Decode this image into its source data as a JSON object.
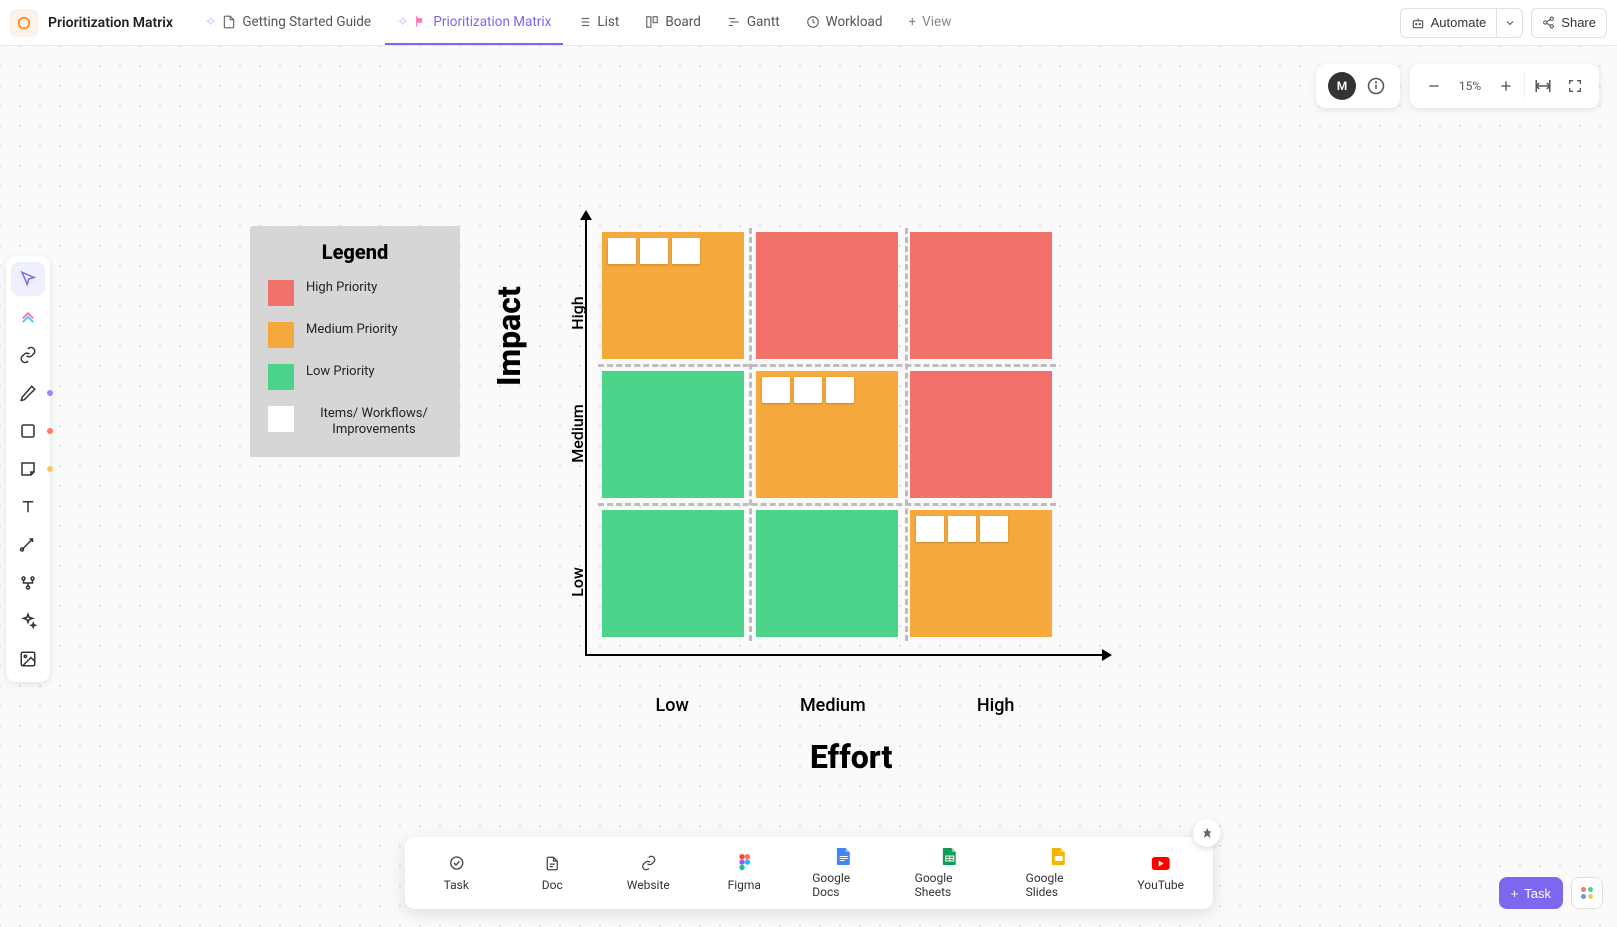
{
  "header": {
    "page_title": "Prioritization Matrix",
    "tabs": [
      {
        "label": "Getting Started Guide"
      },
      {
        "label": "Prioritization Matrix"
      },
      {
        "label": "List"
      },
      {
        "label": "Board"
      },
      {
        "label": "Gantt"
      },
      {
        "label": "Workload"
      }
    ],
    "add_view_label": "View",
    "automate_label": "Automate",
    "share_label": "Share"
  },
  "presence": {
    "avatar_initial": "M"
  },
  "zoom": {
    "percent_label": "15%"
  },
  "legend": {
    "title": "Legend",
    "items": [
      {
        "label": "High Priority",
        "color": "#f2716a"
      },
      {
        "label": "Medium Priority",
        "color": "#f5a83c"
      },
      {
        "label": "Low Priority",
        "color": "#4cd58a"
      },
      {
        "label": "Items/ Workflows/ Improvements",
        "color": "#ffffff"
      }
    ]
  },
  "matrix": {
    "y_axis_label": "Impact",
    "x_axis_label": "Effort",
    "y_ticks": [
      "High",
      "Medium",
      "Low"
    ],
    "x_ticks": [
      "Low",
      "Medium",
      "High"
    ],
    "cells": [
      {
        "row": "High",
        "col": "Low",
        "priority": "medium",
        "cards": 3
      },
      {
        "row": "High",
        "col": "Medium",
        "priority": "high",
        "cards": 0
      },
      {
        "row": "High",
        "col": "High",
        "priority": "high",
        "cards": 0
      },
      {
        "row": "Medium",
        "col": "Low",
        "priority": "low",
        "cards": 0
      },
      {
        "row": "Medium",
        "col": "Medium",
        "priority": "medium",
        "cards": 3
      },
      {
        "row": "Medium",
        "col": "High",
        "priority": "high",
        "cards": 0
      },
      {
        "row": "Low",
        "col": "Low",
        "priority": "low",
        "cards": 0
      },
      {
        "row": "Low",
        "col": "Medium",
        "priority": "low",
        "cards": 0
      },
      {
        "row": "Low",
        "col": "High",
        "priority": "medium",
        "cards": 3
      }
    ]
  },
  "quickadd": {
    "items": [
      {
        "label": "Task"
      },
      {
        "label": "Doc"
      },
      {
        "label": "Website"
      },
      {
        "label": "Figma"
      },
      {
        "label": "Google Docs"
      },
      {
        "label": "Google Sheets"
      },
      {
        "label": "Google Slides"
      },
      {
        "label": "YouTube"
      }
    ]
  },
  "bottom_right": {
    "task_label": "Task"
  }
}
